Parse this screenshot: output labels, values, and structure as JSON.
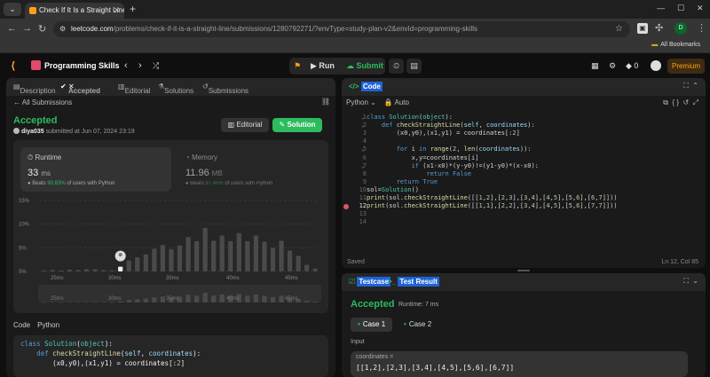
{
  "browser": {
    "tab_title": "Check If It Is a Straight Line - Le",
    "url_host": "leetcode.com",
    "url_path": "/problems/check-if-it-is-a-straight-line/submissions/1280792271/?envType=study-plan-v2&envId=programming-skills",
    "all_bookmarks": "All Bookmarks",
    "profile_initial": "D"
  },
  "lc_header": {
    "list_title": "Programming Skills",
    "run_label": "Run",
    "submit_label": "Submit",
    "streak": "0",
    "premium_label": "Premium"
  },
  "left_tabs": {
    "description": "Description",
    "accepted": "Accepted",
    "editorial": "Editorial",
    "solutions": "Solutions",
    "submissions": "Submissions"
  },
  "submission": {
    "all_submissions": "All Submissions",
    "status": "Accepted",
    "user": "diya035",
    "submitted_at": "submitted at Jun 07, 2024 23:19",
    "editorial_btn": "Editorial",
    "solution_btn": "Solution"
  },
  "runtime": {
    "label": "Runtime",
    "value": "33",
    "unit": "ms",
    "beats_prefix": "Beats",
    "beats_pct": "90.83%",
    "beats_suffix": "of users with Python"
  },
  "memory": {
    "label": "Memory",
    "value": "11.96",
    "unit": "MB",
    "beats_prefix": "Beats",
    "beats_pct": "97.45%",
    "beats_suffix": "of users with Python"
  },
  "chart_data": {
    "type": "bar",
    "y_ticks": [
      "15%",
      "10%",
      "5%",
      "0%"
    ],
    "ylim": [
      0,
      15
    ],
    "x_ticks": [
      "25ms",
      "30ms",
      "35ms",
      "40ms",
      "45ms"
    ],
    "values": [
      0.2,
      0.3,
      0.2,
      0.4,
      0.3,
      0.5,
      0.5,
      0.3,
      0.2,
      1.0,
      2.3,
      3.0,
      3.6,
      4.8,
      5.6,
      4.7,
      5.5,
      7.3,
      6.4,
      9.2,
      6.5,
      7.6,
      6.4,
      8.1,
      6.4,
      7.6,
      6.3,
      5.0,
      6.5,
      4.4,
      3.3,
      1.4,
      0.6
    ],
    "highlight_index": 9
  },
  "code_section": {
    "label": "Code",
    "lang": "Python",
    "lines": [
      "class Solution(object):",
      "    def checkStraightLine(self, coordinates):",
      "        (x0,y0),(x1,y1) = coordinates[:2]"
    ]
  },
  "editor": {
    "title": "Code",
    "lang": "Python",
    "mode": "Auto",
    "saved": "Saved",
    "position": "Ln 12, Col 85",
    "line_numbers": [
      "1",
      "2",
      "3",
      "4",
      "5",
      "6",
      "7",
      "8",
      "9",
      "10",
      "11",
      "12",
      "13",
      "14"
    ],
    "lines": [
      "class Solution(object):",
      "    def checkStraightLine(self, coordinates):",
      "        (x0,y0),(x1,y1) = coordinates[:2]",
      "",
      "        for i in range(2, len(coordinates)):",
      "            x,y=coordinates[i]",
      "            if (x1-x0)*(y-y0)!=(y1-y0)*(x-x0):",
      "                return False",
      "        return True",
      "sol=Solution()",
      "print(sol.checkStraightLine([[1,2],[2,3],[3,4],[4,5],[5,6],[6,7]]))",
      "print(sol.checkStraightLine([[1,1],[2,2],[3,4],[4,5],[5,6],[7,7]]))",
      "",
      ""
    ]
  },
  "result": {
    "tab_testcase": "Testcase",
    "tab_result": "Test Result",
    "status": "Accepted",
    "runtime": "Runtime: 7 ms",
    "case1": "Case 1",
    "case2": "Case 2",
    "input_label": "Input",
    "param_name": "coordinates =",
    "param_value": "[[1,2],[2,3],[3,4],[4,5],[5,6],[6,7]]"
  }
}
